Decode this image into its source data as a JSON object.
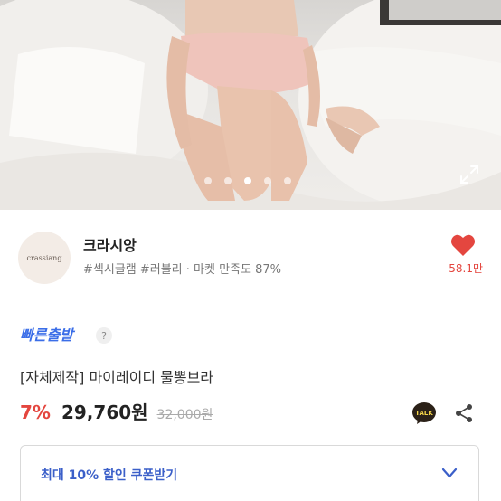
{
  "gallery": {
    "total_pages": 5,
    "current_page": 3
  },
  "seller": {
    "avatar_text": "crassiang",
    "name": "크라시앙",
    "tags": "#섹시글램 #러블리 · 마켓 만족도 87%",
    "likes": "58.1만"
  },
  "product": {
    "badge": "빠른출발",
    "help_label": "?",
    "title": "[자체제작] 마이레이디 물뽕브라",
    "discount": "7%",
    "price": "29,760원",
    "original_price": "32,000원",
    "talk_label": "TALK"
  },
  "coupon": {
    "label": "최대 10% 할인 쿠폰받기"
  },
  "colors": {
    "accent_red": "#e4463f",
    "brand_blue": "#3b6ee8",
    "coupon_blue": "#3b5fc9"
  }
}
